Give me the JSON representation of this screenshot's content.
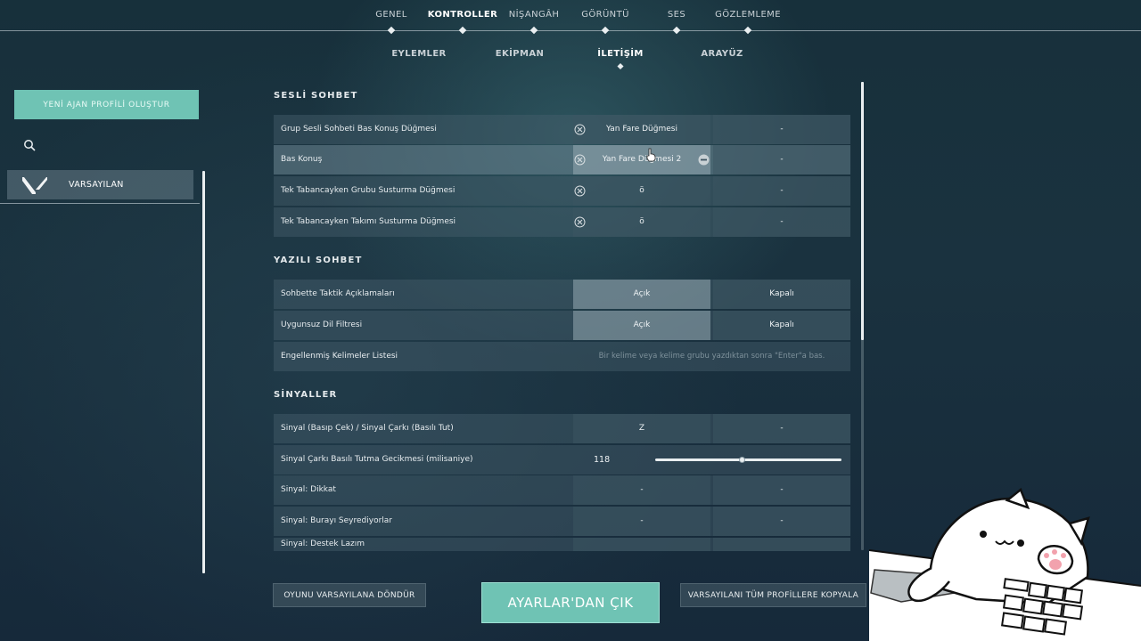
{
  "top_tabs": [
    {
      "label": "GENEL",
      "active": false
    },
    {
      "label": "KONTROLLER",
      "active": true
    },
    {
      "label": "NİŞANGÂH",
      "active": false
    },
    {
      "label": "GÖRÜNTÜ",
      "active": false
    },
    {
      "label": "SES",
      "active": false
    },
    {
      "label": "GÖZLEMLEME",
      "active": false
    }
  ],
  "sub_tabs": [
    {
      "label": "EYLEMLER",
      "active": false
    },
    {
      "label": "EKİPMAN",
      "active": false
    },
    {
      "label": "İLETİŞİM",
      "active": true
    },
    {
      "label": "ARAYÜZ",
      "active": false
    }
  ],
  "sidebar": {
    "new_profile_label": "YENİ AJAN PROFİLİ OLUŞTUR",
    "profile_label": "VARSAYILAN"
  },
  "sections": {
    "voice": {
      "title": "SESLİ SOHBET",
      "rows": [
        {
          "label": "Grup Sesli Sohbeti Bas Konuş Düğmesi",
          "primary": "Yan Fare Düğmesi",
          "secondary": "-"
        },
        {
          "label": "Bas Konuş",
          "primary": "Yan Fare Düğmesi 2",
          "secondary": "-"
        },
        {
          "label": "Tek Tabancayken Grubu Susturma Düğmesi",
          "primary": "ö",
          "secondary": "-"
        },
        {
          "label": "Tek Tabancayken Takımı Susturma Düğmesi",
          "primary": "ö",
          "secondary": "-"
        }
      ]
    },
    "text": {
      "title": "YAZILI SOHBET",
      "rows": [
        {
          "label": "Sohbette Taktik Açıklamaları",
          "primary": "Açık",
          "secondary": "Kapalı"
        },
        {
          "label": "Uygunsuz Dil Filtresi",
          "primary": "Açık",
          "secondary": "Kapalı"
        },
        {
          "label": "Engellenmiş Kelimeler Listesi",
          "placeholder": "Bir kelime veya kelime grubu yazdıktan sonra \"Enter\"a bas."
        }
      ]
    },
    "pings": {
      "title": "SİNYALLER",
      "rows": [
        {
          "label": "Sinyal (Basıp Çek) / Sinyal Çarkı (Basılı Tut)",
          "primary": "Z",
          "secondary": "-"
        },
        {
          "label": "Sinyal Çarkı Basılı Tutma Gecikmesi (milisaniye)",
          "value": "118",
          "slider_fraction": 0.47
        },
        {
          "label": "Sinyal: Dikkat",
          "primary": "-",
          "secondary": "-"
        },
        {
          "label": "Sinyal: Burayı Seyrediyorlar",
          "primary": "-",
          "secondary": "-"
        },
        {
          "label": "Sinyal: Destek Lazım"
        }
      ]
    }
  },
  "footer": {
    "reset_label": "OYUNU VARSAYILANA DÖNDÜR",
    "exit_label": "AYARLAR'DAN ÇIK",
    "copy_label": "VARSAYILANI TÜM PROFİLLERE KOPYALA"
  },
  "colors": {
    "accent": "#6fc3b4",
    "background": "#1a323f"
  }
}
